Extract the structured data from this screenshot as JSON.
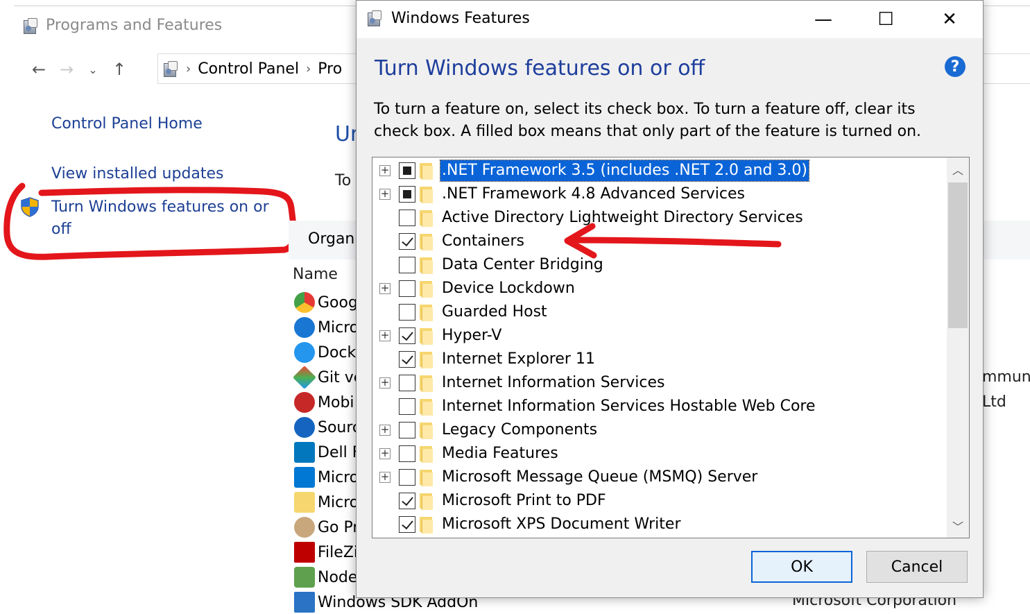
{
  "background": {
    "window_title": "Programs and Features",
    "address": {
      "root": "Control Panel",
      "next": "Pro"
    },
    "left_links": [
      "Control Panel Home",
      "View installed updates",
      "Turn Windows features on or",
      "off"
    ],
    "heading_fragment": "Ur",
    "subtext_fragment": "To",
    "toolbar_fragment": "Organi",
    "column_name": "Name",
    "programs": [
      "Goog",
      "Micro",
      "Dock",
      "Git ve",
      "Mobi",
      "Sourc",
      "Dell F",
      "Micro",
      "Micro",
      "Go Pr",
      "FileZi",
      "Node",
      "Windows SDK AddOn"
    ],
    "right_fragments": [
      "mmuni",
      "Ltd",
      "Microsoft Corporation"
    ]
  },
  "dialog": {
    "title": "Windows Features",
    "minimize": "—",
    "maximize": "☐",
    "close": "✕",
    "heading": "Turn Windows features on or off",
    "help": "?",
    "description": "To turn a feature on, select its check box. To turn a feature off, clear its check box. A filled box means that only part of the feature is turned on.",
    "features": [
      {
        "label": ".NET Framework 3.5 (includes .NET 2.0 and 3.0)",
        "state": "partial",
        "expandable": true,
        "selected": true
      },
      {
        "label": ".NET Framework 4.8 Advanced Services",
        "state": "partial",
        "expandable": true,
        "selected": false
      },
      {
        "label": "Active Directory Lightweight Directory Services",
        "state": "unchecked",
        "expandable": false,
        "selected": false
      },
      {
        "label": "Containers",
        "state": "checked",
        "expandable": false,
        "selected": false
      },
      {
        "label": "Data Center Bridging",
        "state": "unchecked",
        "expandable": false,
        "selected": false
      },
      {
        "label": "Device Lockdown",
        "state": "unchecked",
        "expandable": true,
        "selected": false
      },
      {
        "label": "Guarded Host",
        "state": "unchecked",
        "expandable": false,
        "selected": false
      },
      {
        "label": "Hyper-V",
        "state": "checked",
        "expandable": true,
        "selected": false
      },
      {
        "label": "Internet Explorer 11",
        "state": "checked",
        "expandable": false,
        "selected": false
      },
      {
        "label": "Internet Information Services",
        "state": "unchecked",
        "expandable": true,
        "selected": false
      },
      {
        "label": "Internet Information Services Hostable Web Core",
        "state": "unchecked",
        "expandable": false,
        "selected": false
      },
      {
        "label": "Legacy Components",
        "state": "unchecked",
        "expandable": true,
        "selected": false
      },
      {
        "label": "Media Features",
        "state": "unchecked",
        "expandable": true,
        "selected": false
      },
      {
        "label": "Microsoft Message Queue (MSMQ) Server",
        "state": "unchecked",
        "expandable": true,
        "selected": false
      },
      {
        "label": "Microsoft Print to PDF",
        "state": "checked",
        "expandable": false,
        "selected": false
      },
      {
        "label": "Microsoft XPS Document Writer",
        "state": "checked",
        "expandable": false,
        "selected": false
      }
    ],
    "ok_label": "OK",
    "cancel_label": "Cancel"
  },
  "colors": {
    "accent": "#0a64d8",
    "heading": "#1e3e9c",
    "annotation": "#e3161b",
    "link": "#1c3f94"
  }
}
